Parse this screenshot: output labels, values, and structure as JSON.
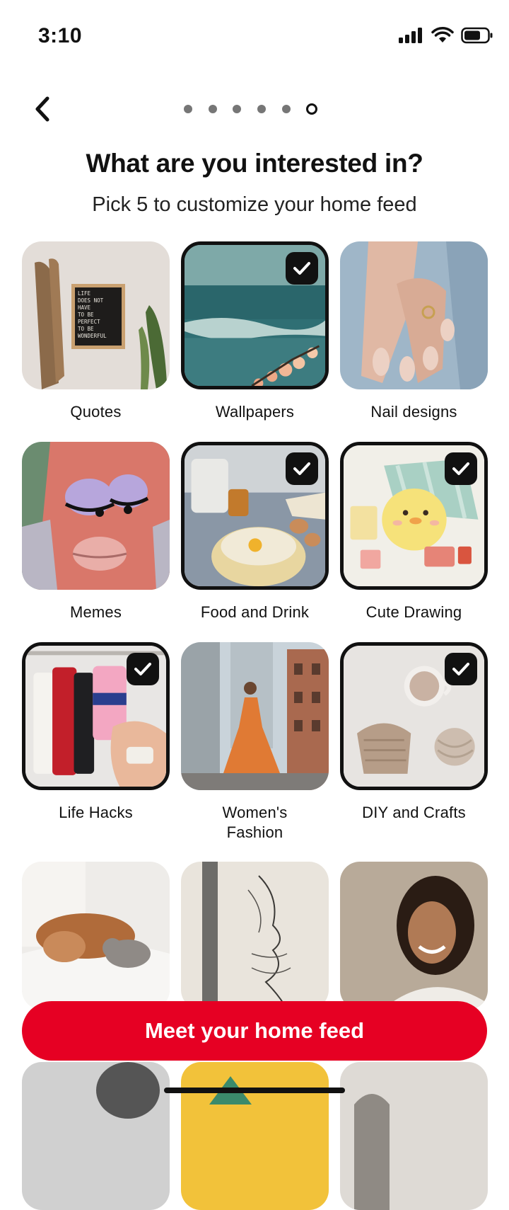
{
  "status": {
    "time": "3:10"
  },
  "header": {
    "title": "What are you interested in?",
    "subtitle": "Pick 5 to customize your home feed",
    "step_count": 6,
    "active_step": 6
  },
  "topics": [
    {
      "label": "Quotes",
      "selected": false
    },
    {
      "label": "Wallpapers",
      "selected": true
    },
    {
      "label": "Nail designs",
      "selected": false
    },
    {
      "label": "Memes",
      "selected": false
    },
    {
      "label": "Food and Drink",
      "selected": true
    },
    {
      "label": "Cute Drawing",
      "selected": true
    },
    {
      "label": "Life Hacks",
      "selected": true
    },
    {
      "label": "Women's Fashion",
      "selected": false
    },
    {
      "label": "DIY and Crafts",
      "selected": true
    }
  ],
  "quote_board_text": "LIFE DOES NOT HAVE TO BE PERFECT TO BE WONDERFUL",
  "cta": {
    "label": "Meet your home feed",
    "color": "#e60023"
  }
}
